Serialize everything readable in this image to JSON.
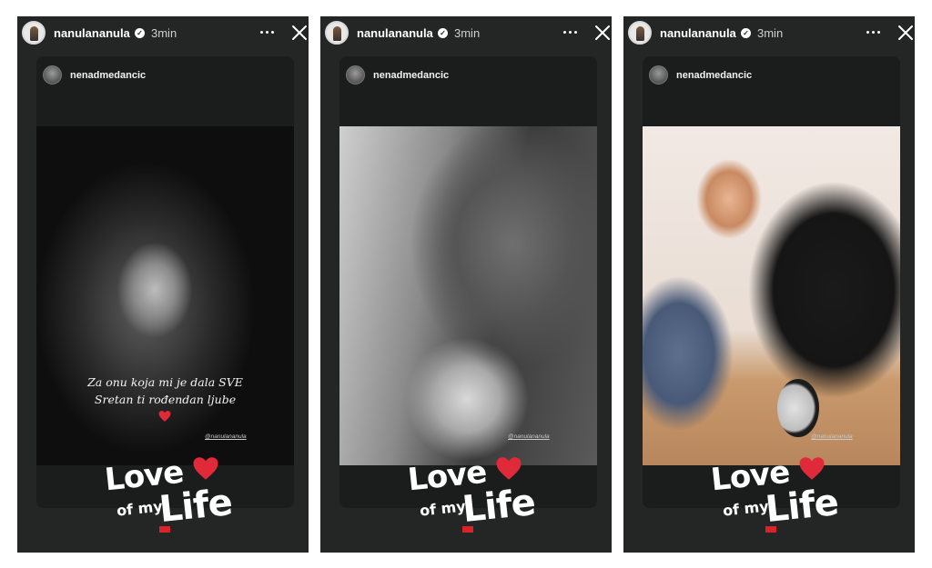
{
  "stories": [
    {
      "username": "nanulananula",
      "time": "3min",
      "repost_username": "nenadmedancic",
      "caption_lines": [
        "Za onu koja mi je dala SVE",
        "Sretan ti rođendan ljube"
      ],
      "tag": "@nanulananula",
      "logo": {
        "love": "Love",
        "of_my": "of my",
        "life": "Life"
      }
    },
    {
      "username": "nanulananula",
      "time": "3min",
      "repost_username": "nenadmedancic",
      "tag": "@nanulananula",
      "logo": {
        "love": "Love",
        "of_my": "of my",
        "life": "Life"
      }
    },
    {
      "username": "nanulananula",
      "time": "3min",
      "repost_username": "nenadmedancic",
      "tag": "@nanulananula",
      "logo": {
        "love": "Love",
        "of_my": "of my",
        "life": "Life"
      }
    }
  ],
  "colors": {
    "story_bg": "#242626",
    "card_bg": "#1b1d1d",
    "heart_red": "#e02a3a"
  },
  "icons": [
    "verified-badge-icon",
    "more-options-icon",
    "close-icon",
    "heart-icon"
  ]
}
